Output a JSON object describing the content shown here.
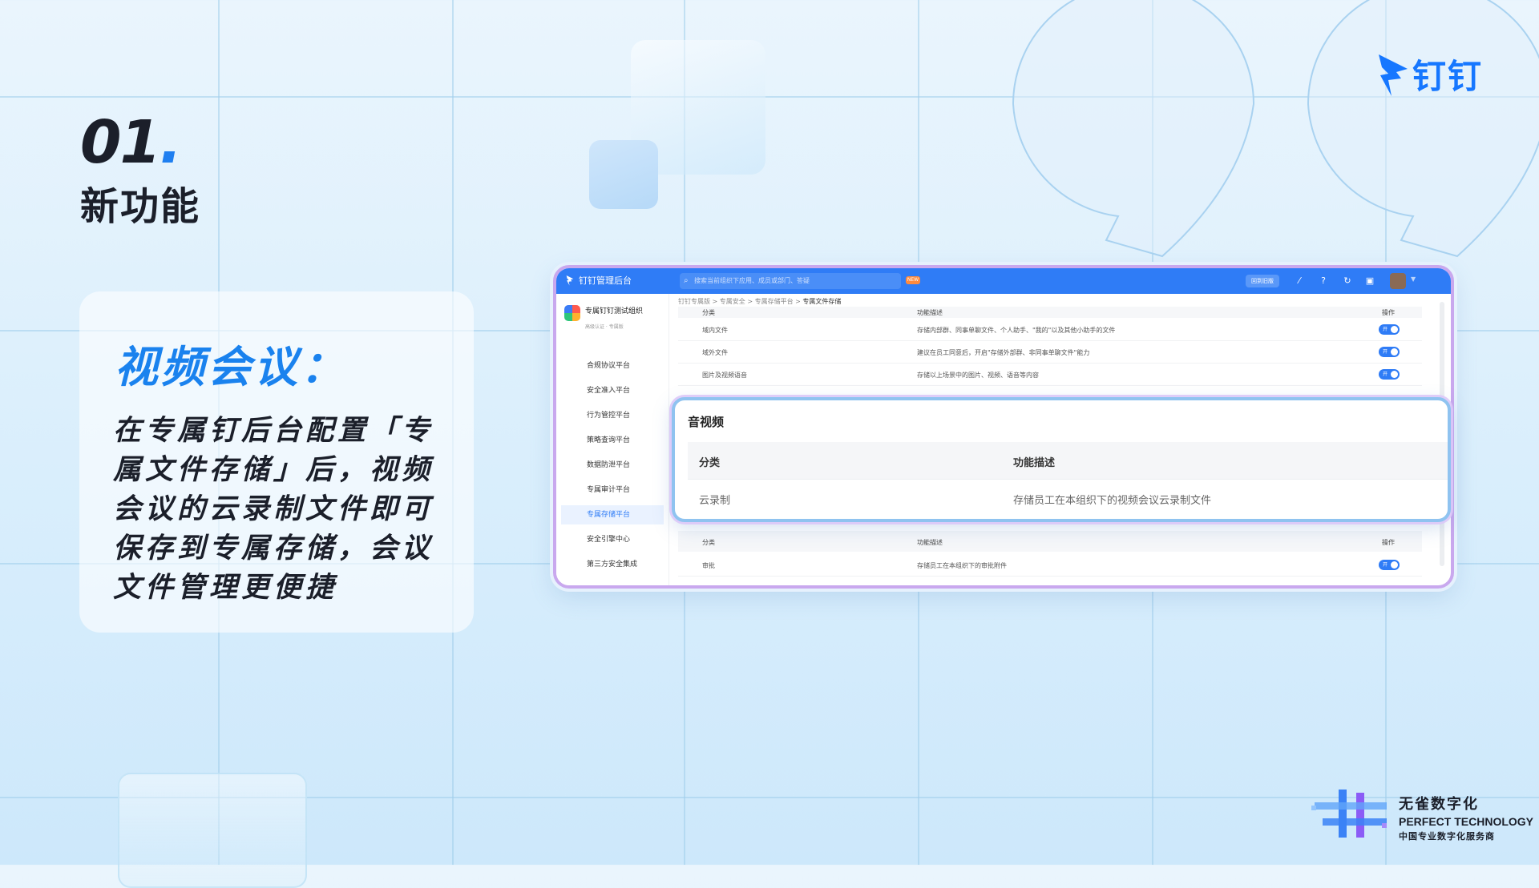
{
  "slide": {
    "number": "01",
    "number_dot": ".",
    "subtitle": "新功能",
    "brand_logo_text": "钉钉"
  },
  "info_card": {
    "title": "视频会议：",
    "body": "在专属钉后台配置「专属文件存储」后，视频会议的云录制文件即可保存到专属存储，会议文件管理更便捷"
  },
  "app": {
    "title": "钉钉管理后台",
    "search_placeholder": "搜索当前组织下应用、成员或部门、答疑",
    "new_badge": "NEW",
    "top_button": "回到旧版",
    "org_name": "专属钉钉测试组织",
    "org_tags": "高级认证 · 专属版",
    "sidebar_items": [
      {
        "label": "合规协议平台",
        "active": false
      },
      {
        "label": "安全准入平台",
        "active": false
      },
      {
        "label": "行为管控平台",
        "active": false
      },
      {
        "label": "策略查询平台",
        "active": false
      },
      {
        "label": "数据防泄平台",
        "active": false
      },
      {
        "label": "专属审计平台",
        "active": false
      },
      {
        "label": "专属存储平台",
        "active": true
      },
      {
        "label": "安全引擎中心",
        "active": false
      },
      {
        "label": "第三方安全集成",
        "active": false
      }
    ],
    "breadcrumb": [
      "钉钉专属版",
      "专属安全",
      "专属存储平台",
      "专属文件存储"
    ],
    "table_top_headers": {
      "c1": "分类",
      "c2": "功能描述",
      "c3": "操作"
    },
    "rows_top": [
      {
        "name": "域内文件",
        "desc": "存储内部群、同事单聊文件、个人助手、\"我的\"以及其他小助手的文件",
        "toggle": "开"
      },
      {
        "name": "域外文件",
        "desc": "建议在员工同意后，开启\"存储外部群、非同事单聊文件\"能力",
        "toggle": "开"
      },
      {
        "name": "图片及视频语音",
        "desc": "存储以上场景中的图片、视频、语音等内容",
        "toggle": "开"
      }
    ],
    "table_bottom_headers": {
      "c1": "分类",
      "c2": "功能描述",
      "c3": "操作"
    },
    "rows_bottom": [
      {
        "name": "审批",
        "desc": "存储员工在本组织下的审批附件",
        "toggle": "开"
      }
    ]
  },
  "zoom_panel": {
    "title": "音视频",
    "header_c1": "分类",
    "header_c2": "功能描述",
    "row_c1": "云录制",
    "row_c2": "存储员工在本组织下的视频会议云录制文件"
  },
  "footer": {
    "line1": "无雀数字化",
    "line2": "PERFECT TECHNOLOGY",
    "line3": "中国专业数字化服务商"
  },
  "colors": {
    "accent": "#1677ff",
    "title_blue": "#1a82ee",
    "app_header": "#2f7cf6"
  }
}
